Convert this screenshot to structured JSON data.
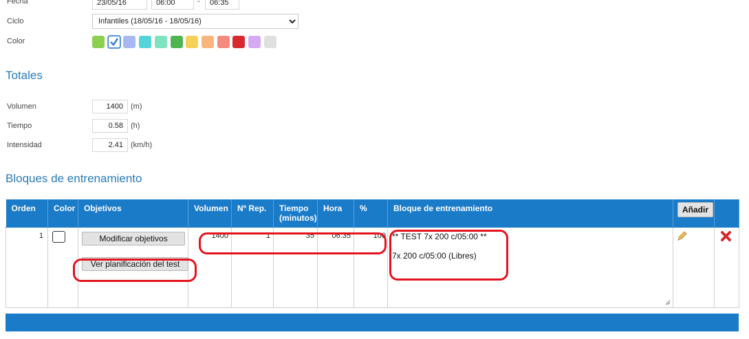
{
  "form": {
    "fecha_label": "Fecha",
    "fecha_value": "23/05/16",
    "hora_inicio": "06:00",
    "hora_sep": "-",
    "hora_fin": "06:35",
    "ciclo_label": "Ciclo",
    "ciclo_value": "Infantiles (18/05/16 - 18/05/16)",
    "color_label": "Color",
    "colors": [
      "#8bd14f",
      "#3a7fd5",
      "#a7b8f3",
      "#53d4d8",
      "#7ee3bf",
      "#4fb551",
      "#f6d15a",
      "#f9b67a",
      "#f58a7f",
      "#d62a2f",
      "#d5aaf2",
      "#e0e0e0"
    ],
    "selected_color_index": 1
  },
  "totales": {
    "title": "Totales",
    "volumen_label": "Volumen",
    "volumen_value": "1400",
    "volumen_unit": "(m)",
    "tiempo_label": "Tiempo",
    "tiempo_value": "0.58",
    "tiempo_unit": "(h)",
    "intensidad_label": "Intensidad",
    "intensidad_value": "2.41",
    "intensidad_unit": "(km/h)"
  },
  "bloques": {
    "title": "Bloques de entrenamiento",
    "headers": {
      "orden": "Orden",
      "color": "Color",
      "objetivos": "Objetivos",
      "volumen": "Volumen",
      "nrep": "Nº Rep.",
      "tiempo": "Tiempo",
      "tiempo_sub": "(minutos)",
      "hora": "Hora",
      "pct": "%",
      "bloque": "Bloque de entrenamiento",
      "add_button": "Añadir"
    },
    "row": {
      "orden": "1",
      "modificar_button": "Modificar objetivos",
      "ver_button": "Ver planificación del test",
      "volumen": "1400",
      "nrep": "1",
      "tiempo": "35",
      "hora": "06:35",
      "pct": "100",
      "bloque_line1": "** TEST 7x 200 c/05:00 **",
      "bloque_line2": "7x 200 c/05:00 (Libres)"
    }
  }
}
